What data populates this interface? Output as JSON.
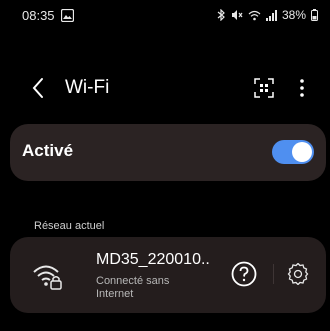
{
  "status_bar": {
    "time": "08:35",
    "battery": "38%",
    "icons": [
      "image-icon",
      "bluetooth-icon",
      "mute-icon",
      "wifi-icon",
      "signal-icon",
      "battery-icon"
    ]
  },
  "header": {
    "title": "Wi-Fi",
    "back_icon": "back-icon",
    "qr_icon": "qr-scan-icon",
    "more_icon": "more-vert-icon"
  },
  "wifi_toggle": {
    "label": "Activé",
    "state": true,
    "accent": "#4f8ff0"
  },
  "current_network": {
    "section_label": "Réseau actuel",
    "name": "MD35_220010..",
    "status": "Connecté sans Internet",
    "icons": [
      "wifi-locked-icon",
      "help-icon",
      "settings-icon"
    ]
  },
  "colors": {
    "background": "#000000",
    "card": "#2b2323",
    "network_card": "#241d1d",
    "toggle_on": "#4f8ff0"
  }
}
